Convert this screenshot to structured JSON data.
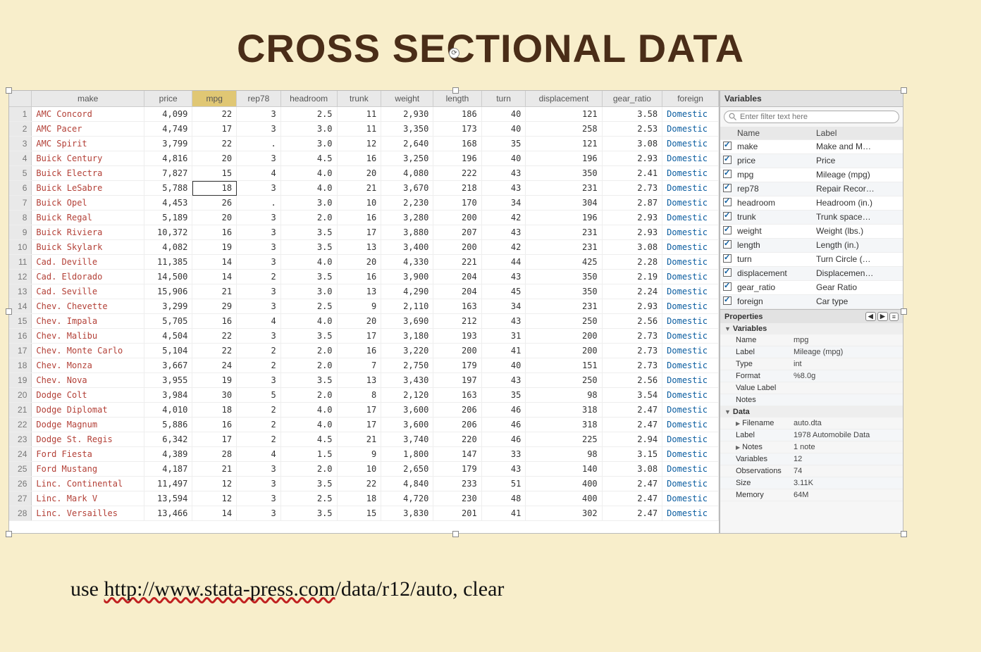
{
  "title": "CROSS SECTIONAL DATA",
  "footer_prefix": "use ",
  "footer_url": "http://www.stata-press.com",
  "footer_suffix": "/data/r12/auto, clear",
  "columns": [
    "make",
    "price",
    "mpg",
    "rep78",
    "headroom",
    "trunk",
    "weight",
    "length",
    "turn",
    "displacement",
    "gear_ratio",
    "foreign"
  ],
  "selected_column": "mpg",
  "selected_row": 6,
  "rows": [
    {
      "n": 1,
      "make": "AMC Concord",
      "price": "4,099",
      "mpg": "22",
      "rep78": "3",
      "headroom": "2.5",
      "trunk": "11",
      "weight": "2,930",
      "length": "186",
      "turn": "40",
      "displacement": "121",
      "gear_ratio": "3.58",
      "foreign": "Domestic"
    },
    {
      "n": 2,
      "make": "AMC Pacer",
      "price": "4,749",
      "mpg": "17",
      "rep78": "3",
      "headroom": "3.0",
      "trunk": "11",
      "weight": "3,350",
      "length": "173",
      "turn": "40",
      "displacement": "258",
      "gear_ratio": "2.53",
      "foreign": "Domestic"
    },
    {
      "n": 3,
      "make": "AMC Spirit",
      "price": "3,799",
      "mpg": "22",
      "rep78": ".",
      "headroom": "3.0",
      "trunk": "12",
      "weight": "2,640",
      "length": "168",
      "turn": "35",
      "displacement": "121",
      "gear_ratio": "3.08",
      "foreign": "Domestic"
    },
    {
      "n": 4,
      "make": "Buick Century",
      "price": "4,816",
      "mpg": "20",
      "rep78": "3",
      "headroom": "4.5",
      "trunk": "16",
      "weight": "3,250",
      "length": "196",
      "turn": "40",
      "displacement": "196",
      "gear_ratio": "2.93",
      "foreign": "Domestic"
    },
    {
      "n": 5,
      "make": "Buick Electra",
      "price": "7,827",
      "mpg": "15",
      "rep78": "4",
      "headroom": "4.0",
      "trunk": "20",
      "weight": "4,080",
      "length": "222",
      "turn": "43",
      "displacement": "350",
      "gear_ratio": "2.41",
      "foreign": "Domestic"
    },
    {
      "n": 6,
      "make": "Buick LeSabre",
      "price": "5,788",
      "mpg": "18",
      "rep78": "3",
      "headroom": "4.0",
      "trunk": "21",
      "weight": "3,670",
      "length": "218",
      "turn": "43",
      "displacement": "231",
      "gear_ratio": "2.73",
      "foreign": "Domestic"
    },
    {
      "n": 7,
      "make": "Buick Opel",
      "price": "4,453",
      "mpg": "26",
      "rep78": ".",
      "headroom": "3.0",
      "trunk": "10",
      "weight": "2,230",
      "length": "170",
      "turn": "34",
      "displacement": "304",
      "gear_ratio": "2.87",
      "foreign": "Domestic"
    },
    {
      "n": 8,
      "make": "Buick Regal",
      "price": "5,189",
      "mpg": "20",
      "rep78": "3",
      "headroom": "2.0",
      "trunk": "16",
      "weight": "3,280",
      "length": "200",
      "turn": "42",
      "displacement": "196",
      "gear_ratio": "2.93",
      "foreign": "Domestic"
    },
    {
      "n": 9,
      "make": "Buick Riviera",
      "price": "10,372",
      "mpg": "16",
      "rep78": "3",
      "headroom": "3.5",
      "trunk": "17",
      "weight": "3,880",
      "length": "207",
      "turn": "43",
      "displacement": "231",
      "gear_ratio": "2.93",
      "foreign": "Domestic"
    },
    {
      "n": 10,
      "make": "Buick Skylark",
      "price": "4,082",
      "mpg": "19",
      "rep78": "3",
      "headroom": "3.5",
      "trunk": "13",
      "weight": "3,400",
      "length": "200",
      "turn": "42",
      "displacement": "231",
      "gear_ratio": "3.08",
      "foreign": "Domestic"
    },
    {
      "n": 11,
      "make": "Cad. Deville",
      "price": "11,385",
      "mpg": "14",
      "rep78": "3",
      "headroom": "4.0",
      "trunk": "20",
      "weight": "4,330",
      "length": "221",
      "turn": "44",
      "displacement": "425",
      "gear_ratio": "2.28",
      "foreign": "Domestic"
    },
    {
      "n": 12,
      "make": "Cad. Eldorado",
      "price": "14,500",
      "mpg": "14",
      "rep78": "2",
      "headroom": "3.5",
      "trunk": "16",
      "weight": "3,900",
      "length": "204",
      "turn": "43",
      "displacement": "350",
      "gear_ratio": "2.19",
      "foreign": "Domestic"
    },
    {
      "n": 13,
      "make": "Cad. Seville",
      "price": "15,906",
      "mpg": "21",
      "rep78": "3",
      "headroom": "3.0",
      "trunk": "13",
      "weight": "4,290",
      "length": "204",
      "turn": "45",
      "displacement": "350",
      "gear_ratio": "2.24",
      "foreign": "Domestic"
    },
    {
      "n": 14,
      "make": "Chev. Chevette",
      "price": "3,299",
      "mpg": "29",
      "rep78": "3",
      "headroom": "2.5",
      "trunk": "9",
      "weight": "2,110",
      "length": "163",
      "turn": "34",
      "displacement": "231",
      "gear_ratio": "2.93",
      "foreign": "Domestic"
    },
    {
      "n": 15,
      "make": "Chev. Impala",
      "price": "5,705",
      "mpg": "16",
      "rep78": "4",
      "headroom": "4.0",
      "trunk": "20",
      "weight": "3,690",
      "length": "212",
      "turn": "43",
      "displacement": "250",
      "gear_ratio": "2.56",
      "foreign": "Domestic"
    },
    {
      "n": 16,
      "make": "Chev. Malibu",
      "price": "4,504",
      "mpg": "22",
      "rep78": "3",
      "headroom": "3.5",
      "trunk": "17",
      "weight": "3,180",
      "length": "193",
      "turn": "31",
      "displacement": "200",
      "gear_ratio": "2.73",
      "foreign": "Domestic"
    },
    {
      "n": 17,
      "make": "Chev. Monte Carlo",
      "price": "5,104",
      "mpg": "22",
      "rep78": "2",
      "headroom": "2.0",
      "trunk": "16",
      "weight": "3,220",
      "length": "200",
      "turn": "41",
      "displacement": "200",
      "gear_ratio": "2.73",
      "foreign": "Domestic"
    },
    {
      "n": 18,
      "make": "Chev. Monza",
      "price": "3,667",
      "mpg": "24",
      "rep78": "2",
      "headroom": "2.0",
      "trunk": "7",
      "weight": "2,750",
      "length": "179",
      "turn": "40",
      "displacement": "151",
      "gear_ratio": "2.73",
      "foreign": "Domestic"
    },
    {
      "n": 19,
      "make": "Chev. Nova",
      "price": "3,955",
      "mpg": "19",
      "rep78": "3",
      "headroom": "3.5",
      "trunk": "13",
      "weight": "3,430",
      "length": "197",
      "turn": "43",
      "displacement": "250",
      "gear_ratio": "2.56",
      "foreign": "Domestic"
    },
    {
      "n": 20,
      "make": "Dodge Colt",
      "price": "3,984",
      "mpg": "30",
      "rep78": "5",
      "headroom": "2.0",
      "trunk": "8",
      "weight": "2,120",
      "length": "163",
      "turn": "35",
      "displacement": "98",
      "gear_ratio": "3.54",
      "foreign": "Domestic"
    },
    {
      "n": 21,
      "make": "Dodge Diplomat",
      "price": "4,010",
      "mpg": "18",
      "rep78": "2",
      "headroom": "4.0",
      "trunk": "17",
      "weight": "3,600",
      "length": "206",
      "turn": "46",
      "displacement": "318",
      "gear_ratio": "2.47",
      "foreign": "Domestic"
    },
    {
      "n": 22,
      "make": "Dodge Magnum",
      "price": "5,886",
      "mpg": "16",
      "rep78": "2",
      "headroom": "4.0",
      "trunk": "17",
      "weight": "3,600",
      "length": "206",
      "turn": "46",
      "displacement": "318",
      "gear_ratio": "2.47",
      "foreign": "Domestic"
    },
    {
      "n": 23,
      "make": "Dodge St. Regis",
      "price": "6,342",
      "mpg": "17",
      "rep78": "2",
      "headroom": "4.5",
      "trunk": "21",
      "weight": "3,740",
      "length": "220",
      "turn": "46",
      "displacement": "225",
      "gear_ratio": "2.94",
      "foreign": "Domestic"
    },
    {
      "n": 24,
      "make": "Ford Fiesta",
      "price": "4,389",
      "mpg": "28",
      "rep78": "4",
      "headroom": "1.5",
      "trunk": "9",
      "weight": "1,800",
      "length": "147",
      "turn": "33",
      "displacement": "98",
      "gear_ratio": "3.15",
      "foreign": "Domestic"
    },
    {
      "n": 25,
      "make": "Ford Mustang",
      "price": "4,187",
      "mpg": "21",
      "rep78": "3",
      "headroom": "2.0",
      "trunk": "10",
      "weight": "2,650",
      "length": "179",
      "turn": "43",
      "displacement": "140",
      "gear_ratio": "3.08",
      "foreign": "Domestic"
    },
    {
      "n": 26,
      "make": "Linc. Continental",
      "price": "11,497",
      "mpg": "12",
      "rep78": "3",
      "headroom": "3.5",
      "trunk": "22",
      "weight": "4,840",
      "length": "233",
      "turn": "51",
      "displacement": "400",
      "gear_ratio": "2.47",
      "foreign": "Domestic"
    },
    {
      "n": 27,
      "make": "Linc. Mark V",
      "price": "13,594",
      "mpg": "12",
      "rep78": "3",
      "headroom": "2.5",
      "trunk": "18",
      "weight": "4,720",
      "length": "230",
      "turn": "48",
      "displacement": "400",
      "gear_ratio": "2.47",
      "foreign": "Domestic"
    },
    {
      "n": 28,
      "make": "Linc. Versailles",
      "price": "13,466",
      "mpg": "14",
      "rep78": "3",
      "headroom": "3.5",
      "trunk": "15",
      "weight": "3,830",
      "length": "201",
      "turn": "41",
      "displacement": "302",
      "gear_ratio": "2.47",
      "foreign": "Domestic"
    }
  ],
  "varpanel": {
    "title": "Variables",
    "filter_placeholder": "Enter filter text here",
    "header_name": "Name",
    "header_label": "Label",
    "items": [
      {
        "name": "make",
        "label": "Make and M…"
      },
      {
        "name": "price",
        "label": "Price"
      },
      {
        "name": "mpg",
        "label": "Mileage (mpg)"
      },
      {
        "name": "rep78",
        "label": "Repair Recor…"
      },
      {
        "name": "headroom",
        "label": "Headroom (in.)"
      },
      {
        "name": "trunk",
        "label": "Trunk space…"
      },
      {
        "name": "weight",
        "label": "Weight (lbs.)"
      },
      {
        "name": "length",
        "label": "Length (in.)"
      },
      {
        "name": "turn",
        "label": "Turn Circle (…"
      },
      {
        "name": "displacement",
        "label": "Displacemen…"
      },
      {
        "name": "gear_ratio",
        "label": "Gear Ratio"
      },
      {
        "name": "foreign",
        "label": "Car type"
      }
    ]
  },
  "props": {
    "title": "Properties",
    "section1": "Variables",
    "var_rows": [
      {
        "k": "Name",
        "v": "mpg"
      },
      {
        "k": "Label",
        "v": "Mileage (mpg)"
      },
      {
        "k": "Type",
        "v": "int"
      },
      {
        "k": "Format",
        "v": "%8.0g"
      },
      {
        "k": "Value Label",
        "v": ""
      },
      {
        "k": "Notes",
        "v": ""
      }
    ],
    "section2": "Data",
    "data_rows": [
      {
        "k": "Filename",
        "v": "auto.dta",
        "tri": "▶"
      },
      {
        "k": "Label",
        "v": "1978 Automobile Data"
      },
      {
        "k": "Notes",
        "v": "1 note",
        "tri": "▶"
      },
      {
        "k": "Variables",
        "v": "12"
      },
      {
        "k": "Observations",
        "v": "74"
      },
      {
        "k": "Size",
        "v": "3.11K"
      },
      {
        "k": "Memory",
        "v": "64M"
      }
    ]
  }
}
